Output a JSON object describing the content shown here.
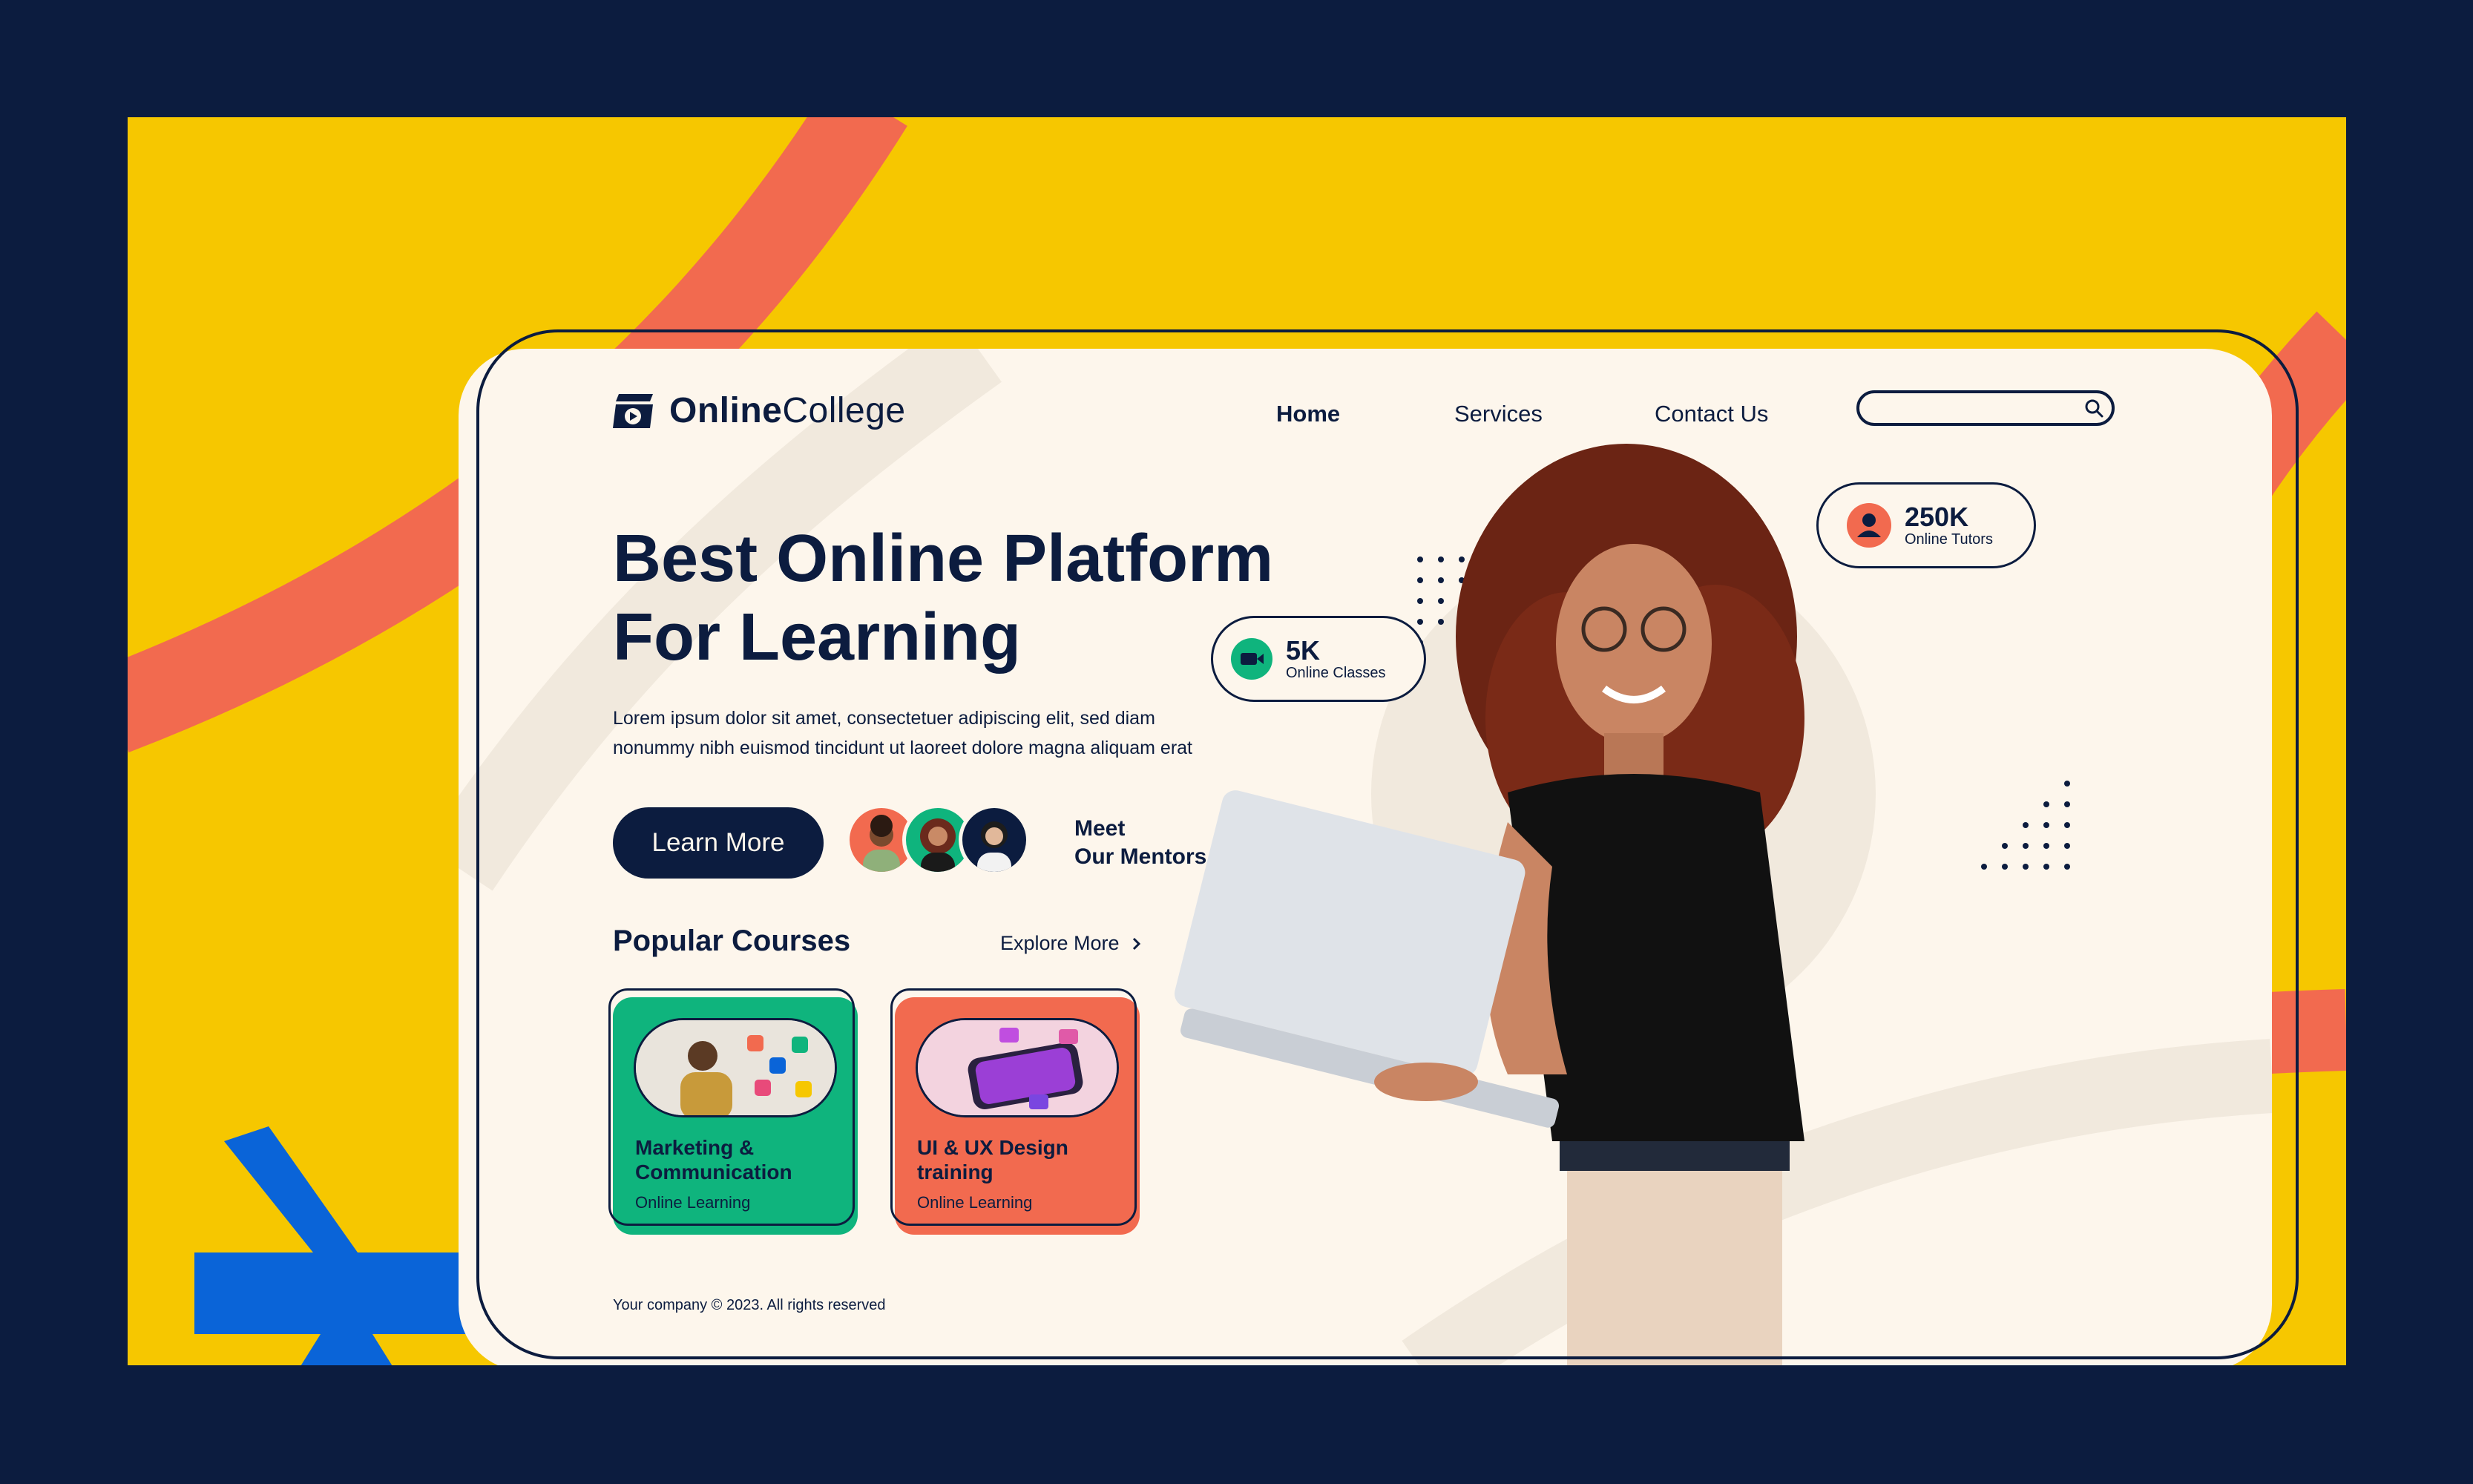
{
  "brand": {
    "bold": "Online",
    "regular": "College"
  },
  "nav": {
    "home": "Home",
    "services": "Services",
    "contact": "Contact Us",
    "search_placeholder": ""
  },
  "hero": {
    "title_line1": "Best Online Platform",
    "title_line2": "For Learning",
    "description_line1": "Lorem ipsum dolor sit amet, consectetuer adipiscing elit, sed diam",
    "description_line2": "nonummy nibh euismod tincidunt ut laoreet dolore magna aliquam erat",
    "cta": "Learn More",
    "mentors_line1": "Meet",
    "mentors_line2": "Our Mentors"
  },
  "courses": {
    "title": "Popular Courses",
    "explore": "Explore More",
    "items": [
      {
        "title_line1": "Marketing &",
        "title_line2": "Communication",
        "subtitle": "Online Learning",
        "color": "#0fb47d"
      },
      {
        "title_line1": "UI & UX Design",
        "title_line2": "training",
        "subtitle": "Online Learning",
        "color": "#f26a4f"
      }
    ]
  },
  "stats": {
    "classes": {
      "value": "5K",
      "label": "Online Classes",
      "icon": "video-camera-icon"
    },
    "tutors": {
      "value": "250K",
      "label": "Online Tutors",
      "icon": "user-icon"
    }
  },
  "footer": {
    "copyright": "Your company © 2023. All rights reserved"
  },
  "colors": {
    "navy": "#0c1c3f",
    "yellow": "#f6c700",
    "coral": "#f26a4f",
    "green": "#0fb47d",
    "blue": "#0a64d8",
    "cream": "#fdf6ec"
  }
}
